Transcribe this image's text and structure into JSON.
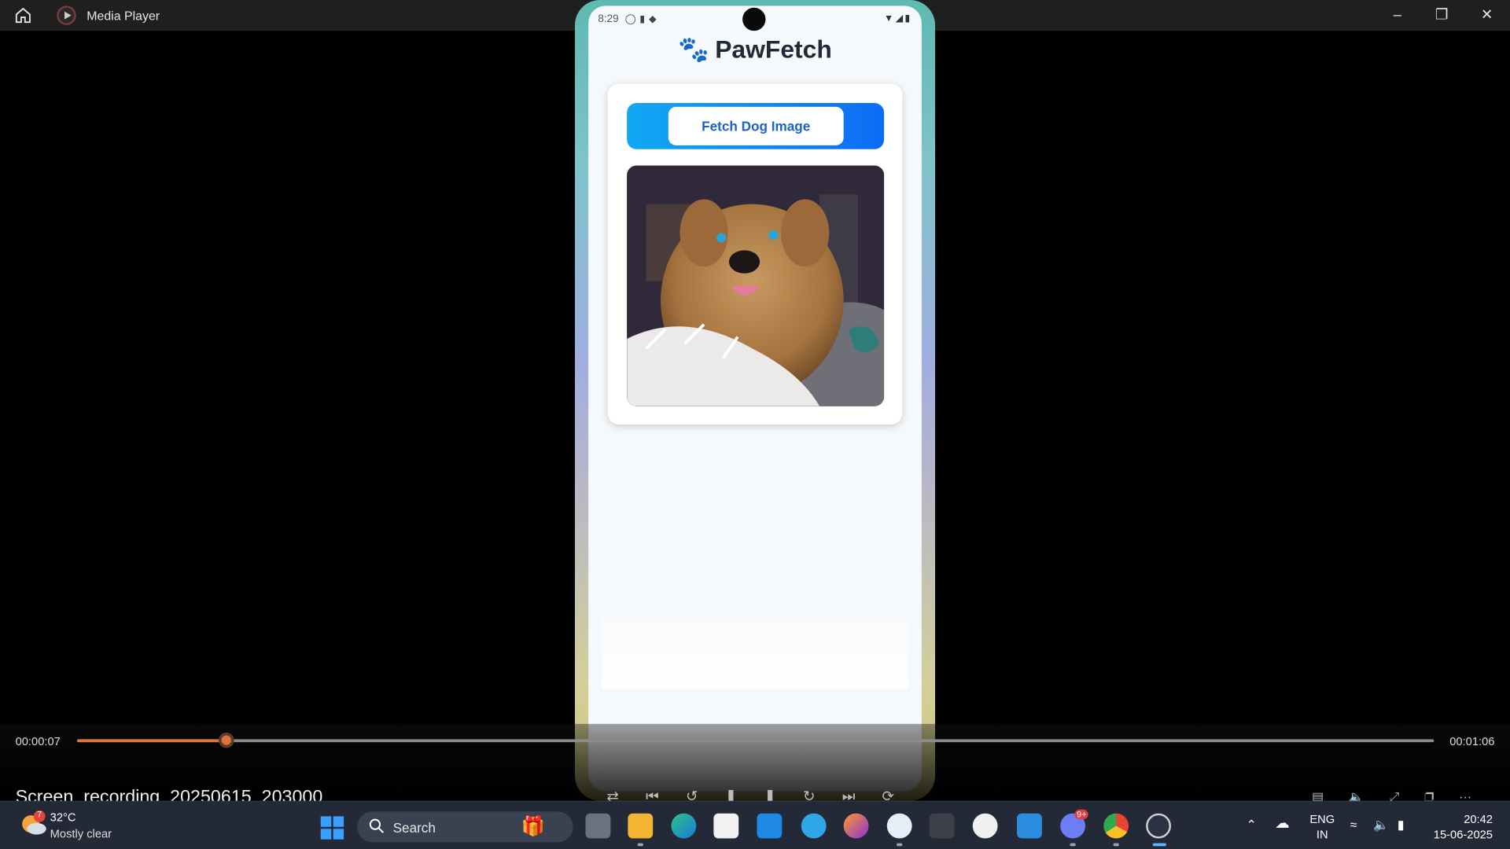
{
  "window": {
    "title": "Media Player",
    "controls": [
      "minimize",
      "restore",
      "close"
    ]
  },
  "phone": {
    "status_time": "8:29",
    "app_title": "PawFetch",
    "fetch_button_label": "Fetch Dog Image",
    "image_alt": "dog image"
  },
  "player": {
    "current_time": "00:00:07",
    "total_time": "00:01:06",
    "progress_fraction": 0.11,
    "file_name": "Screen_recording_20250615_203000"
  },
  "taskbar": {
    "weather_temp": "32°C",
    "weather_desc": "Mostly clear",
    "weather_badge": "7",
    "search_placeholder": "Search",
    "discord_badge": "9+",
    "lang_primary": "ENG",
    "lang_secondary": "IN",
    "time": "20:42",
    "date": "15-06-2025"
  },
  "colors": {
    "accent": "#e0703f",
    "fetch_gradient_start": "#12a8f3",
    "fetch_gradient_end": "#0d6cf5",
    "fetch_text": "#1c62c9"
  }
}
